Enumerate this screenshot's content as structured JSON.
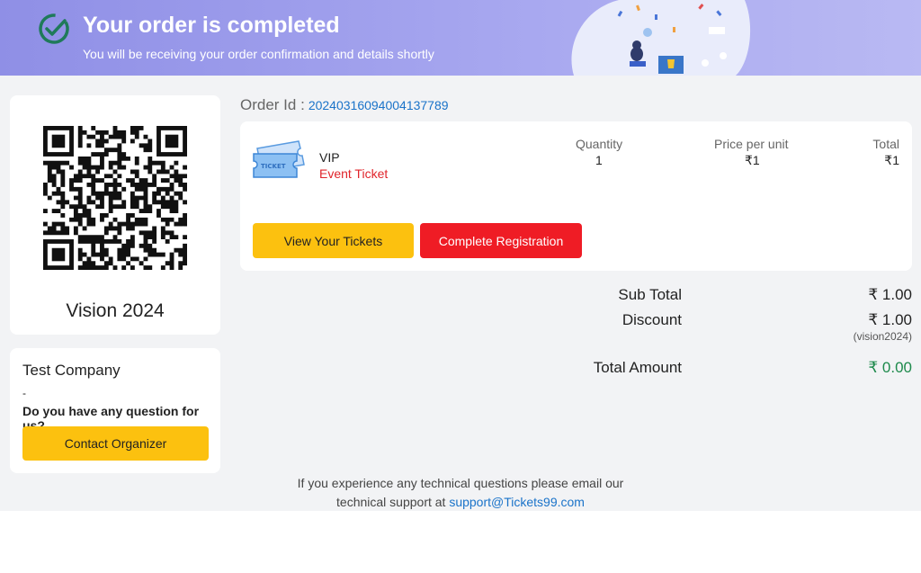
{
  "banner": {
    "title": "Your order is completed",
    "subtitle": "You will be receiving your order confirmation and details shortly"
  },
  "event": {
    "name": "Vision 2024"
  },
  "organizer": {
    "name": "Test Company",
    "dash": "-",
    "question": "Do you have any question for us?",
    "contact_label": "Contact Organizer"
  },
  "order": {
    "id_label": "Order Id :",
    "id_value": "20240316094004137789"
  },
  "ticket": {
    "type": "VIP",
    "kind": "Event Ticket",
    "headers": {
      "quantity": "Quantity",
      "price": "Price per unit",
      "total": "Total"
    },
    "quantity": "1",
    "price": "₹1",
    "total": "₹1",
    "view_label": "View Your Tickets",
    "register_label": "Complete Registration"
  },
  "summary": {
    "subtotal_label": "Sub Total",
    "subtotal_value": "₹ 1.00",
    "discount_label": "Discount",
    "discount_value": "₹ 1.00",
    "discount_code": "(vision2024)",
    "total_label": "Total Amount",
    "total_value": "₹ 0.00"
  },
  "footer": {
    "line1": "If you experience any technical questions please email our",
    "line2": "technical support at",
    "email": "support@Tickets99.com"
  },
  "colors": {
    "accent_yellow": "#fcc10f",
    "accent_red": "#ef1c25",
    "link_blue": "#1a73c9",
    "total_green": "#1e8a4c",
    "banner_purple": "#9f9fec"
  },
  "icons": {
    "banner": "check-circle-icon",
    "ticket": "ticket-icon",
    "qr": "qr-code"
  }
}
